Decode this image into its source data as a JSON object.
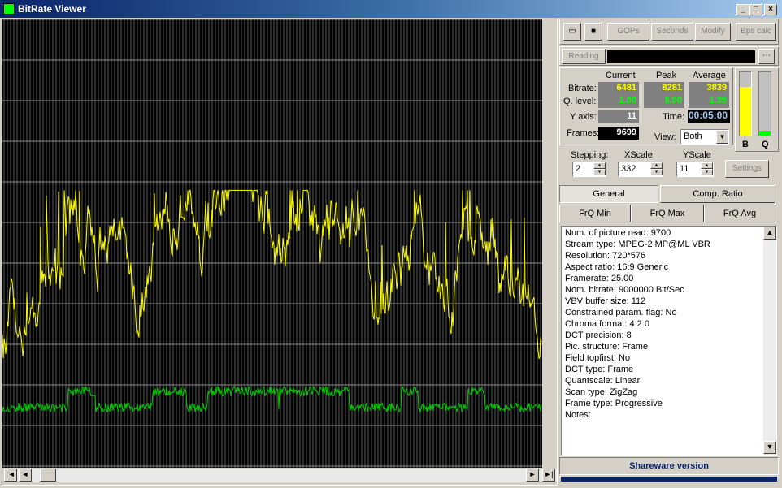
{
  "window": {
    "title": "BitRate Viewer"
  },
  "toolbar": {
    "gops": "GOPs",
    "seconds": "Seconds",
    "modify": "Modify",
    "bps_calc": "Bps calc"
  },
  "reading": {
    "button": "Reading"
  },
  "stats": {
    "col_current": "Current",
    "col_peak": "Peak",
    "col_average": "Average",
    "bitrate_label": "Bitrate:",
    "bitrate_current": "6481",
    "bitrate_peak": "8281",
    "bitrate_average": "3839",
    "qlevel_label": "Q. level:",
    "qlevel_current": "1.00",
    "qlevel_peak": "8.00",
    "qlevel_average": "1.35",
    "yaxis_label": "Y axis:",
    "yaxis_value": "11",
    "time_label": "Time:",
    "time_value": "00:05:00",
    "frames_label": "Frames:",
    "frames_value": "9699",
    "view_label": "View:",
    "view_value": "Both"
  },
  "meters": {
    "b_label": "B",
    "q_label": "Q",
    "b_level": 0.77,
    "q_level": 0.08
  },
  "controls": {
    "stepping_label": "Stepping:",
    "stepping_value": "2",
    "xscale_label": "XScale",
    "xscale_value": "332",
    "yscale_label": "YScale",
    "yscale_value": "11",
    "settings": "Settings"
  },
  "tabs": {
    "general": "General",
    "comp_ratio": "Comp. Ratio",
    "frq_min": "FrQ Min",
    "frq_max": "FrQ Max",
    "frq_avg": "FrQ Avg"
  },
  "info": [
    "Num. of picture read: 9700",
    "Stream type: MPEG-2  MP@ML  VBR",
    "Resolution: 720*576",
    "Aspect ratio: 16:9 Generic",
    "Framerate: 25.00",
    "Nom. bitrate: 9000000 Bit/Sec",
    "VBV buffer size: 112",
    "Constrained param. flag: No",
    "Chroma format: 4:2:0",
    "DCT precision: 8",
    "Pic. structure: Frame",
    "Field topfirst: No",
    "DCT type: Frame",
    "Quantscale: Linear",
    "Scan type: ZigZag",
    "Frame type: Progressive",
    "Notes:"
  ],
  "status": {
    "text": "Shareware version"
  },
  "colors": {
    "bitrate_line": "#ffff00",
    "qlevel_line": "#00cc00",
    "grid": "#5a5a5a"
  }
}
